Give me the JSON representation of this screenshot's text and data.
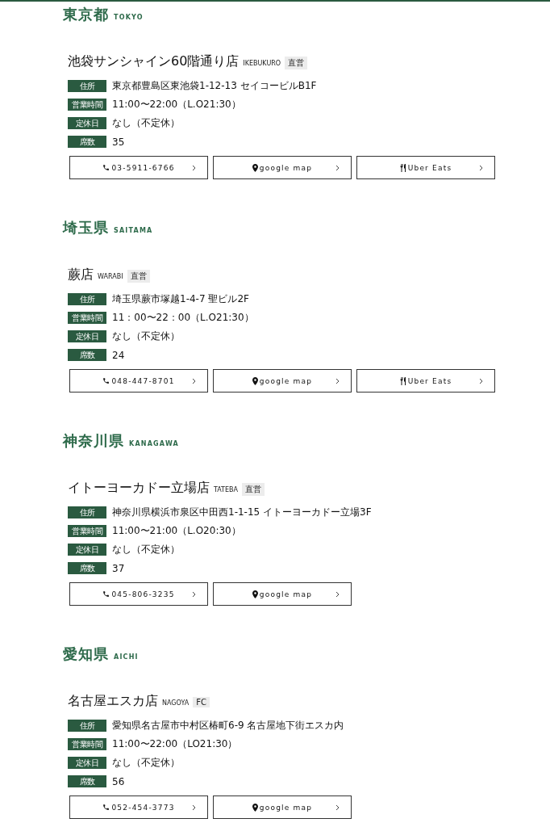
{
  "regions": [
    {
      "name": "東京都",
      "romaji": "TOKYO",
      "stores": [
        {
          "name": "池袋サンシャイン60階通り店",
          "romaji": "IKEBUKURO",
          "badge": "直営",
          "info": [
            {
              "label": "住所",
              "value": "東京都豊島区東池袋1-12-13 セイコービルB1F"
            },
            {
              "label": "営業時間",
              "value": "11:00〜22:00（L.O21:30）"
            },
            {
              "label": "定休日",
              "value": "なし（不定休）"
            },
            {
              "label": "席数",
              "value": "35"
            }
          ],
          "links": [
            {
              "kind": "phone",
              "label": "03-5911-6766"
            },
            {
              "kind": "map",
              "label": "google map"
            },
            {
              "kind": "delivery",
              "label": "Uber Eats"
            }
          ]
        }
      ]
    },
    {
      "name": "埼玉県",
      "romaji": "SAITAMA",
      "stores": [
        {
          "name": "蕨店",
          "romaji": "WARABI",
          "badge": "直営",
          "info": [
            {
              "label": "住所",
              "value": "埼玉県蕨市塚越1-4-7 聖ビル2F"
            },
            {
              "label": "営業時間",
              "value": "11：00〜22：00（L.O21:30）"
            },
            {
              "label": "定休日",
              "value": "なし（不定休）"
            },
            {
              "label": "席数",
              "value": "24"
            }
          ],
          "links": [
            {
              "kind": "phone",
              "label": "048-447-8701"
            },
            {
              "kind": "map",
              "label": "google map"
            },
            {
              "kind": "delivery",
              "label": "Uber Eats"
            }
          ]
        }
      ]
    },
    {
      "name": "神奈川県",
      "romaji": "KANAGAWA",
      "stores": [
        {
          "name": "イトーヨーカドー立場店",
          "romaji": "TATEBA",
          "badge": "直営",
          "info": [
            {
              "label": "住所",
              "value": "神奈川県横浜市泉区中田西1-1-15 イトーヨーカドー立場3F"
            },
            {
              "label": "営業時間",
              "value": "11:00〜21:00（L.O20:30）"
            },
            {
              "label": "定休日",
              "value": "なし（不定休）"
            },
            {
              "label": "席数",
              "value": "37"
            }
          ],
          "links": [
            {
              "kind": "phone",
              "label": "045-806-3235"
            },
            {
              "kind": "map",
              "label": "google map"
            }
          ]
        }
      ]
    },
    {
      "name": "愛知県",
      "romaji": "AICHI",
      "stores": [
        {
          "name": "名古屋エスカ店",
          "romaji": "NAGOYA",
          "badge": "FC",
          "info": [
            {
              "label": "住所",
              "value": "愛知県名古屋市中村区椿町6-9 名古屋地下街エスカ内"
            },
            {
              "label": "営業時間",
              "value": "11:00〜22:00（LO21:30）"
            },
            {
              "label": "定休日",
              "value": "なし（不定休）"
            },
            {
              "label": "席数",
              "value": "56"
            }
          ],
          "links": [
            {
              "kind": "phone",
              "label": "052-454-3773"
            },
            {
              "kind": "map",
              "label": "google map"
            }
          ]
        }
      ]
    }
  ]
}
